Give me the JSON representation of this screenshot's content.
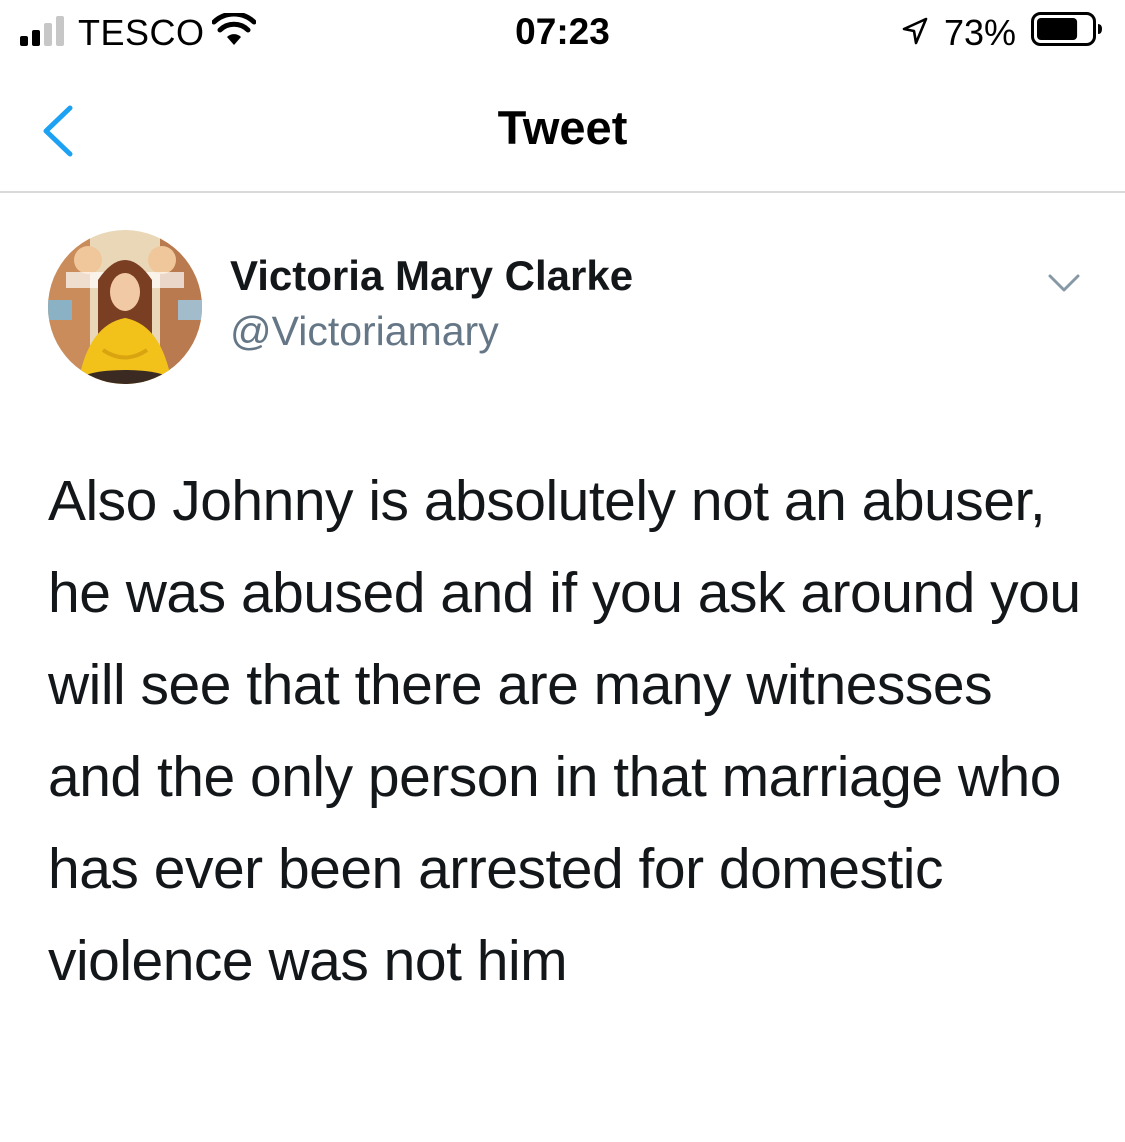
{
  "status_bar": {
    "carrier": "TESCO",
    "time": "07:23",
    "battery_percent": "73%",
    "battery_level": 0.73,
    "icons": [
      "signal-icon",
      "wifi-icon",
      "location-arrow-icon",
      "battery-icon"
    ]
  },
  "nav": {
    "title": "Tweet",
    "back_icon": "chevron-left-icon"
  },
  "tweet": {
    "author_name": "Victoria Mary Clarke",
    "author_handle": "@Victoriamary",
    "menu_icon": "chevron-down-icon",
    "text": "Also Johnny is absolutely not an abuser, he was abused and if you ask around you will see that there are many witnesses and the only person in that marriage who has ever been arrested for domestic violence was not him"
  },
  "colors": {
    "accent": "#1da1f2",
    "handle": "#657786",
    "divider": "#d9d9d9"
  }
}
